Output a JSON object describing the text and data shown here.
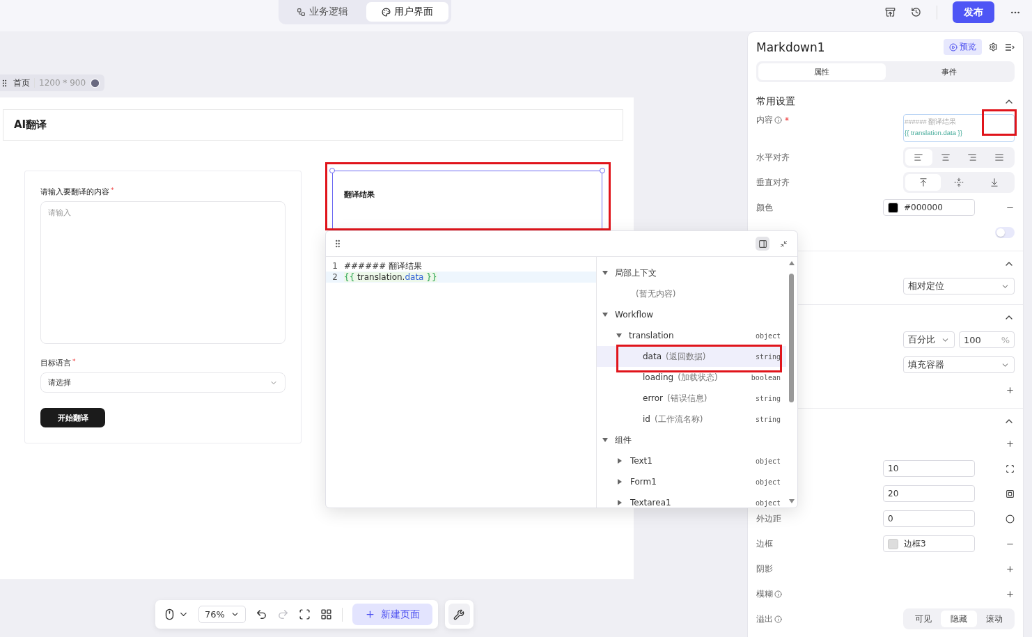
{
  "top_bar": {
    "mode_tabs": [
      {
        "label": "业务逻辑",
        "selected": false
      },
      {
        "label": "用户界面",
        "selected": true
      }
    ],
    "publish_button": "发布"
  },
  "canvas": {
    "page": {
      "name": "首页",
      "size": "1200 * 900"
    },
    "header": {
      "title": "AI翻译"
    },
    "form": {
      "fields": [
        {
          "kind": "textarea",
          "label": "请输入要翻译的内容",
          "required_mark": "*",
          "placeholder": "请输入"
        },
        {
          "kind": "select",
          "label": "目标语言",
          "required_mark": "*",
          "placeholder": "请选择"
        }
      ],
      "submit": "开始翻译"
    },
    "markdown": {
      "text": "翻译结果",
      "selected": true,
      "annotated": true
    }
  },
  "editor_popup": {
    "split_view": true,
    "lines": [
      {
        "number": "1",
        "active": false,
        "tokens": [
          {
            "kind": "text",
            "text": "###### 翻译结果"
          }
        ]
      },
      {
        "number": "2",
        "active": true,
        "tokens": [
          {
            "kind": "brace",
            "text": "{{"
          },
          {
            "kind": "text",
            "text": " translation."
          },
          {
            "kind": "prop",
            "text": "data"
          },
          {
            "kind": "brace",
            "text": " }}"
          }
        ]
      }
    ],
    "tree": [
      {
        "label": "局部上下文",
        "expanded": true,
        "selected": false,
        "children": [
          {
            "kind": "empty",
            "label": "(暂无内容)"
          }
        ]
      },
      {
        "label": "Workflow",
        "expanded": true,
        "selected": false,
        "children": [
          {
            "label": "translation",
            "type": "object",
            "expanded": true,
            "selected": false,
            "children": [
              {
                "label": "data",
                "note": "(返回数据)",
                "type": "string",
                "selected": true,
                "annotated": true
              },
              {
                "label": "loading",
                "note": "(加载状态)",
                "type": "boolean",
                "selected": false
              },
              {
                "label": "error",
                "note": "(错误信息)",
                "type": "string",
                "selected": false
              },
              {
                "label": "id",
                "note": "(工作流名称)",
                "type": "string",
                "selected": false
              }
            ]
          }
        ]
      },
      {
        "label": "组件",
        "expanded": true,
        "selected": false,
        "children": [
          {
            "label": "Text1",
            "type": "object",
            "expanded": false,
            "selected": false
          },
          {
            "label": "Form1",
            "type": "object",
            "expanded": false,
            "selected": false
          },
          {
            "label": "Textarea1",
            "type": "object",
            "expanded": false,
            "selected": false
          }
        ]
      }
    ]
  },
  "panel": {
    "title": "Markdown1",
    "preview_button": "预览",
    "tabs": [
      {
        "label": "属性",
        "selected": true
      },
      {
        "label": "事件",
        "selected": false
      }
    ],
    "sections": [
      {
        "title": "常用设置",
        "expanded": true,
        "rows": [
          {
            "label": "内容",
            "info": true,
            "required_mark": "*",
            "annotated": true,
            "control": {
              "kind": "code",
              "lines": [
                "###### 翻译结果",
                "{{ translation.data }}"
              ]
            }
          },
          {
            "label": "水平对齐",
            "control": {
              "kind": "h_align_segments",
              "options": [
                {
                  "selected": true
                },
                {
                  "selected": false
                },
                {
                  "selected": false
                },
                {
                  "selected": false
                }
              ]
            }
          },
          {
            "label": "垂直对齐",
            "control": {
              "kind": "v_align_segments",
              "options": [
                {
                  "selected": true
                },
                {
                  "selected": false
                },
                {
                  "selected": false
                }
              ]
            }
          },
          {
            "label": "颜色",
            "kind": "remove",
            "control": {
              "kind": "color",
              "value": "#000000",
              "color": "#000000"
            }
          },
          {
            "control": {
              "kind": "switch",
              "on": false
            }
          }
        ]
      },
      {
        "expanded": true,
        "rows": [
          {
            "control": {
              "kind": "select",
              "value": "相对定位"
            }
          }
        ]
      },
      {
        "expanded": true,
        "rows": [
          {
            "control": {
              "kind": "unit_size",
              "unit": "百分比",
              "value": "100",
              "suffix": "%"
            }
          },
          {
            "control": {
              "kind": "select",
              "value": "填充容器"
            }
          },
          {
            "kind": "add"
          }
        ]
      },
      {
        "expanded": true,
        "rows": [
          {
            "kind": "add"
          },
          {
            "kind": "corners",
            "control": {
              "kind": "input",
              "value": "10"
            }
          },
          {
            "kind": "nested_square",
            "control": {
              "kind": "input",
              "value": "20"
            }
          },
          {
            "label": "外边距",
            "kind": "ring",
            "control": {
              "kind": "input",
              "value": "0"
            }
          },
          {
            "label": "边框",
            "kind": "remove",
            "control": {
              "kind": "color",
              "value": "边框3",
              "color": "#dddddd"
            }
          },
          {
            "label": "阴影",
            "kind": "add"
          },
          {
            "label": "模糊",
            "info": true,
            "kind": "add"
          },
          {
            "label": "溢出",
            "info": true,
            "control": {
              "kind": "text_segments",
              "options": [
                {
                  "label": "可见",
                  "selected": false
                },
                {
                  "label": "隐藏",
                  "selected": true
                },
                {
                  "label": "滚动",
                  "selected": false
                }
              ]
            }
          }
        ]
      }
    ]
  },
  "toolbar": {
    "zoom": "76%",
    "redo_disabled": true,
    "new_page_button": "新建页面"
  }
}
